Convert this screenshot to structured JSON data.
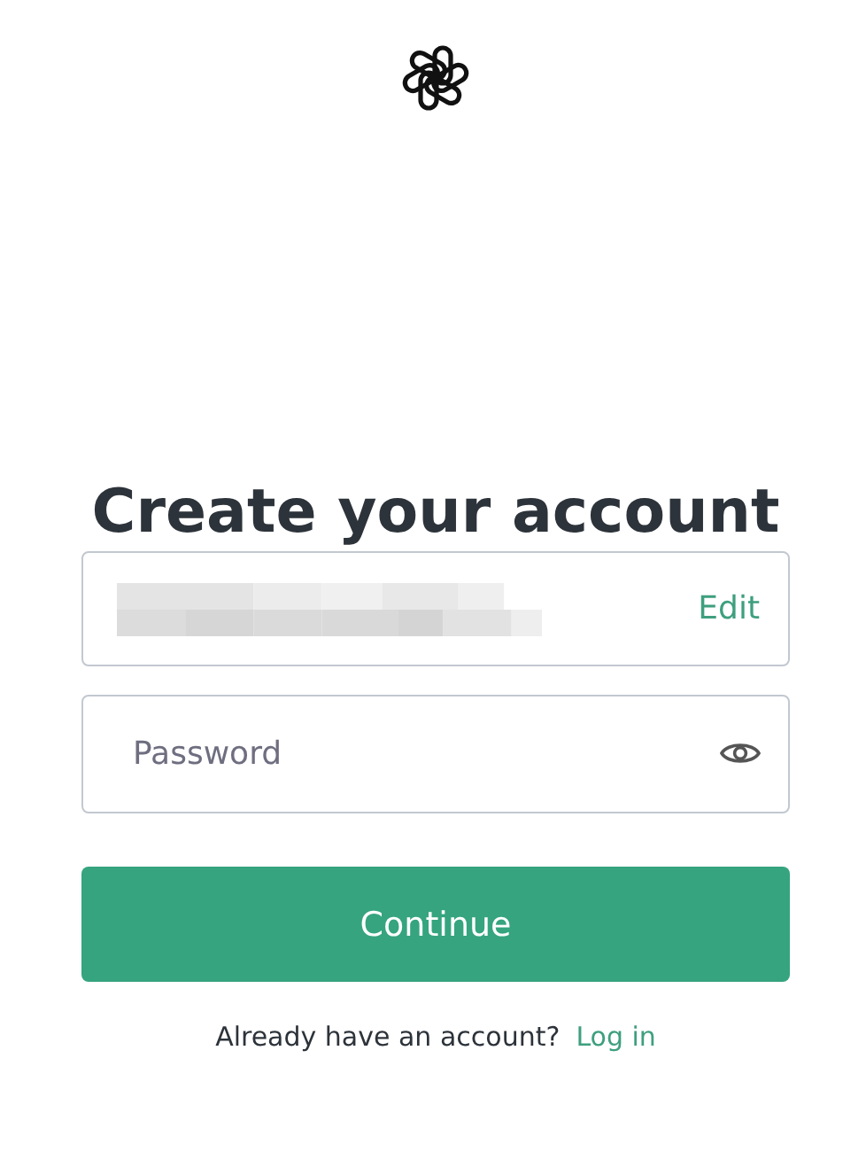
{
  "heading": "Create your account",
  "email_field": {
    "redacted": true,
    "action": "Edit"
  },
  "password_field": {
    "placeholder": "Password"
  },
  "continue_button": "Continue",
  "footer": {
    "prompt": "Already have an account?",
    "link": "Log in"
  }
}
